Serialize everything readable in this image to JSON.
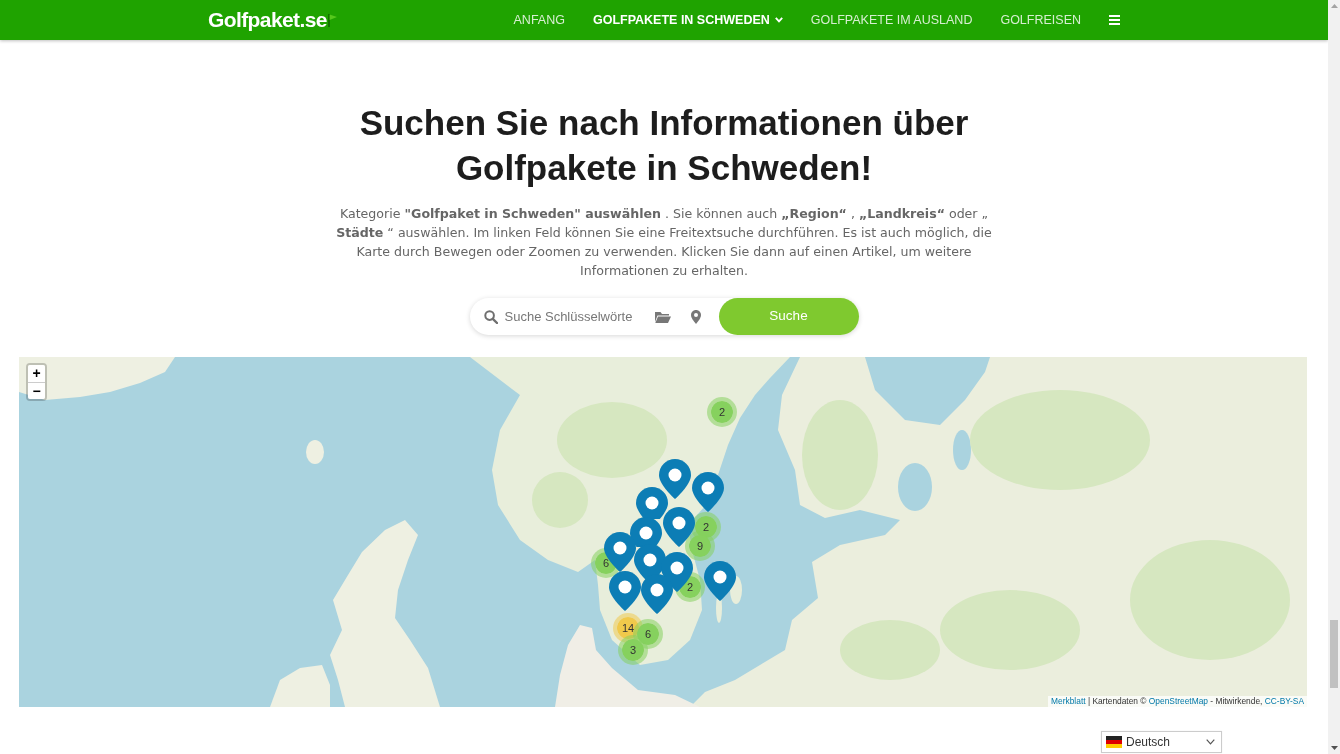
{
  "header": {
    "logo": "Golfpaket.se",
    "nav": [
      {
        "label": "ANFANG",
        "selected": false,
        "dropdown": false
      },
      {
        "label": "GOLFPAKETE IN SCHWEDEN",
        "selected": true,
        "dropdown": true
      },
      {
        "label": "GOLFPAKETE IM AUSLAND",
        "selected": false,
        "dropdown": false
      },
      {
        "label": "GOLFREISEN",
        "selected": false,
        "dropdown": false
      }
    ]
  },
  "title": "Suchen Sie nach Informationen über Golfpakete in Schweden!",
  "intro": "Kategorie **\"Golfpaket in Schweden\" auswählen** . Sie können auch **„Region“** , **„Landkreis“** oder „ **Städte** “ auswählen. Im linken Feld können Sie eine Freitextsuche durchführen. Es ist auch möglich, die Karte durch Bewegen oder Zoomen zu verwenden. Klicken Sie dann auf einen Artikel, um weitere Informationen zu erhalten.",
  "search": {
    "placeholder": "Suche Schlüsselwörte",
    "button": "Suche"
  },
  "map": {
    "zoom_controls": [
      "+",
      "−"
    ],
    "markers": [
      {
        "kind": "cluster",
        "count": "2",
        "color": "#86d15e"
      },
      {
        "kind": "cluster",
        "count": "2",
        "color": "#86d15e"
      },
      {
        "kind": "cluster",
        "count": "9",
        "color": "#86d15e"
      },
      {
        "kind": "cluster",
        "count": "6",
        "color": "#86d15e"
      },
      {
        "kind": "cluster",
        "count": "2",
        "color": "#86d15e"
      },
      {
        "kind": "cluster",
        "count": "14",
        "color": "#f0c94b"
      },
      {
        "kind": "cluster",
        "count": "6",
        "color": "#86d15e"
      },
      {
        "kind": "cluster",
        "count": "3",
        "color": "#86d15e"
      },
      {
        "kind": "pin"
      },
      {
        "kind": "pin"
      },
      {
        "kind": "pin"
      },
      {
        "kind": "pin"
      },
      {
        "kind": "pin"
      },
      {
        "kind": "pin"
      },
      {
        "kind": "pin"
      },
      {
        "kind": "pin"
      },
      {
        "kind": "pin"
      },
      {
        "kind": "pin"
      },
      {
        "kind": "pin"
      }
    ],
    "attribution": [
      {
        "kind": "link",
        "text": "Merkblatt"
      },
      {
        "kind": "text",
        "text": "| Kartendaten ©"
      },
      {
        "kind": "link",
        "text": "OpenStreetMap"
      },
      {
        "kind": "text",
        "text": "- Mitwirkende,"
      },
      {
        "kind": "link",
        "text": "CC-BY-SA"
      }
    ]
  },
  "language": {
    "label": "Deutsch"
  }
}
